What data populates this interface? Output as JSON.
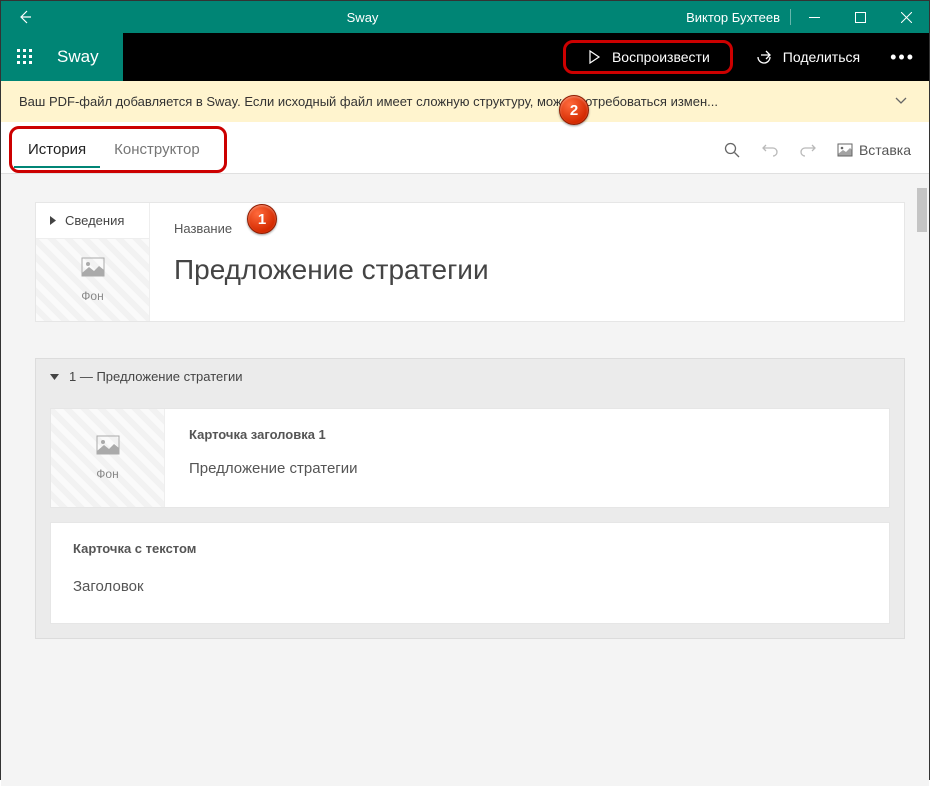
{
  "titlebar": {
    "app": "Sway",
    "user": "Виктор Бухтеев"
  },
  "toolbar": {
    "appname": "Sway",
    "play": "Воспроизвести",
    "share": "Поделиться"
  },
  "infobar": {
    "message": "Ваш PDF-файл добавляется в Sway. Если исходный файл имеет сложную структуру, может потребоваться измен..."
  },
  "tabs": {
    "history": "История",
    "designer": "Конструктор"
  },
  "actions": {
    "insert": "Вставка"
  },
  "card1": {
    "sidehead": "Сведения",
    "bglabel": "Фон",
    "label": "Название",
    "title": "Предложение стратегии"
  },
  "section": {
    "head": "1 — Предложение стратегии",
    "card": {
      "bglabel": "Фон",
      "label": "Карточка заголовка 1",
      "content": "Предложение стратегии"
    },
    "textcard": {
      "label": "Карточка с текстом",
      "content": "Заголовок"
    }
  },
  "badges": {
    "b1": "1",
    "b2": "2"
  }
}
